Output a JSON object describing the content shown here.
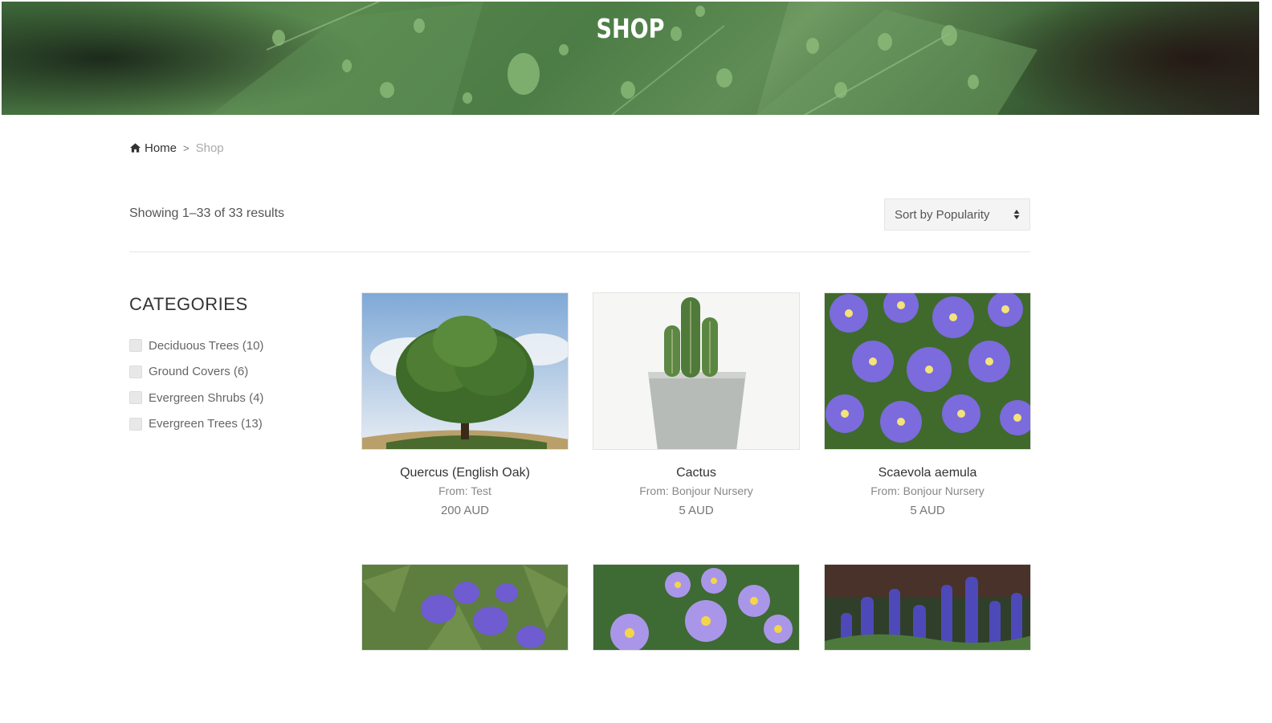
{
  "hero": {
    "title": "SHOP"
  },
  "breadcrumb": {
    "home": "Home",
    "separator": ">",
    "current": "Shop"
  },
  "toolbar": {
    "results_text": "Showing 1–33 of 33 results",
    "sort_selected": "Sort by Popularity"
  },
  "sidebar": {
    "title": "CATEGORIES",
    "categories": [
      {
        "label": "Deciduous Trees (10)"
      },
      {
        "label": "Ground Covers (6)"
      },
      {
        "label": "Evergreen Shrubs (4)"
      },
      {
        "label": "Evergreen Trees (13)"
      }
    ]
  },
  "products": [
    {
      "name": "Quercus (English Oak)",
      "from": "From: Test",
      "price": "200 AUD",
      "image": "oak-tree"
    },
    {
      "name": "Cactus",
      "from": "From: Bonjour Nursery",
      "price": "5 AUD",
      "image": "potted-cactus"
    },
    {
      "name": "Scaevola aemula",
      "from": "From: Bonjour Nursery",
      "price": "5 AUD",
      "image": "purple-fan-flowers"
    },
    {
      "image": "purple-violets"
    },
    {
      "image": "purple-daisies"
    },
    {
      "image": "blue-ajuga"
    }
  ],
  "colors": {
    "accent_dark": "#333333",
    "muted": "#888888",
    "leaf_green": "#4a7a44",
    "flower_purple": "#7a6bd6"
  }
}
